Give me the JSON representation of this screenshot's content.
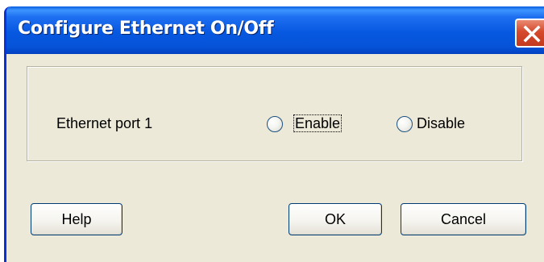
{
  "dialog": {
    "title": "Configure Ethernet On/Off",
    "close_icon": "close-x-icon"
  },
  "group": {
    "port_label": "Ethernet port 1",
    "options": [
      {
        "label": "Enable",
        "selected": false
      },
      {
        "label": "Disable",
        "selected": false
      }
    ]
  },
  "buttons": {
    "help": "Help",
    "ok": "OK",
    "cancel": "Cancel"
  },
  "colors": {
    "title_bar": "#0758e0",
    "dialog_bg": "#ece9d8",
    "close_button": "#d5492c"
  }
}
